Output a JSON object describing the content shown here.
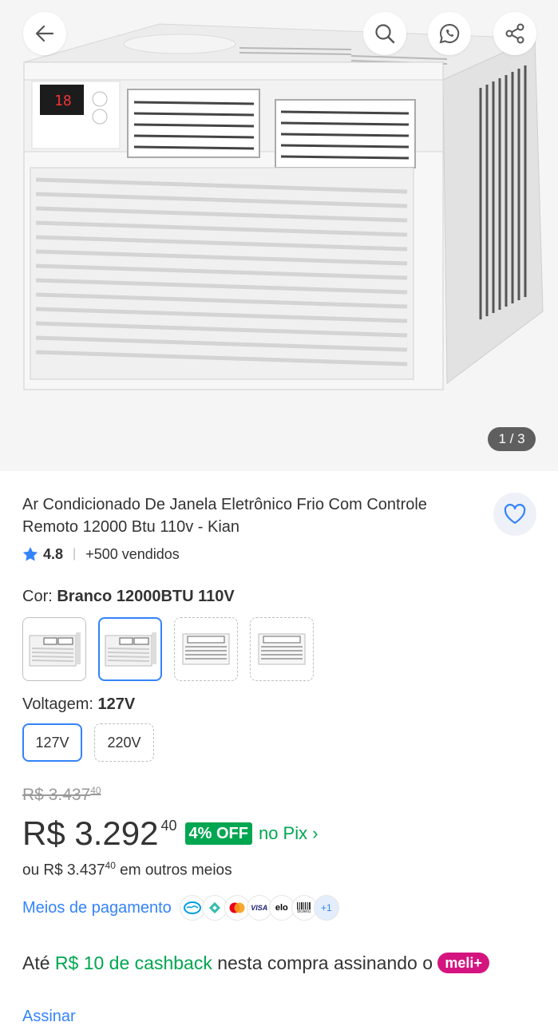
{
  "gallery": {
    "pager": "1 / 3"
  },
  "product": {
    "title": "Ar Condicionado De Janela Eletrônico Frio Com Controle Remoto 12000 Btu 110v - Kian",
    "rating": "4.8",
    "sold": "+500 vendidos",
    "unit_display": "18"
  },
  "color": {
    "label": "Cor:",
    "value": "Branco 12000BTU 110V",
    "selected_index": 1
  },
  "voltage": {
    "label": "Voltagem:",
    "value": "127V",
    "options": [
      "127V",
      "220V"
    ]
  },
  "price": {
    "old_main": "R$ 3.437",
    "old_cents": "40",
    "main": "R$ 3.292",
    "cents": "40",
    "discount": "4% OFF",
    "pix": "no Pix ›",
    "alt_prefix": "ou R$ 3.437",
    "alt_cents": "40",
    "alt_suffix": " em outros meios"
  },
  "payment": {
    "link": "Meios de pagamento",
    "methods": [
      "mercado-pago-icon",
      "pix-icon",
      "mastercard-icon",
      "visa-icon",
      "elo-icon",
      "boleto-icon"
    ],
    "visa": "VISA",
    "elo": "elo",
    "boleto": "Boleto",
    "more": "+1"
  },
  "cashback": {
    "prefix": "Até ",
    "amount": "R$ 10 de cashback",
    "middle": " nesta compra assinando o ",
    "badge": "meli+",
    "link": "Assinar"
  },
  "colors": {
    "accent": "#3483fa",
    "green": "#00a650",
    "meli": "#d5157f"
  }
}
